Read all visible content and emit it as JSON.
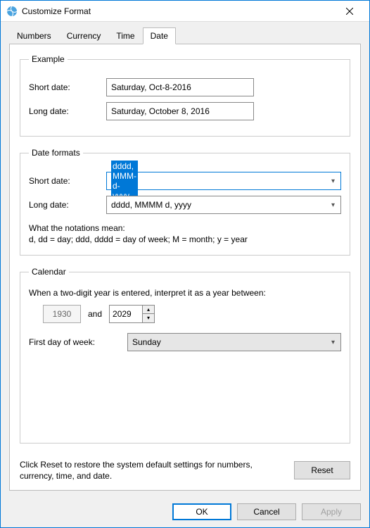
{
  "window": {
    "title": "Customize Format"
  },
  "tabs": {
    "numbers": "Numbers",
    "currency": "Currency",
    "time": "Time",
    "date": "Date",
    "active": "date"
  },
  "example": {
    "legend": "Example",
    "short_label": "Short date:",
    "short_value": "Saturday, Oct-8-2016",
    "long_label": "Long date:",
    "long_value": "Saturday, October 8, 2016"
  },
  "formats": {
    "legend": "Date formats",
    "short_label": "Short date:",
    "short_value": "dddd, MMM-d-yyyy",
    "long_label": "Long date:",
    "long_value": "dddd, MMMM d, yyyy",
    "notation_title": "What the notations mean:",
    "notation_text": "d, dd = day;  ddd, dddd = day of week;  M = month;  y = year"
  },
  "calendar": {
    "legend": "Calendar",
    "two_digit_text": "When a two-digit year is entered, interpret it as a year between:",
    "year_start": "1930",
    "and_label": "and",
    "year_end": "2029",
    "fdow_label": "First day of week:",
    "fdow_value": "Sunday"
  },
  "reset": {
    "text": "Click Reset to restore the system default settings for numbers, currency, time, and date.",
    "button": "Reset"
  },
  "buttons": {
    "ok": "OK",
    "cancel": "Cancel",
    "apply": "Apply"
  }
}
